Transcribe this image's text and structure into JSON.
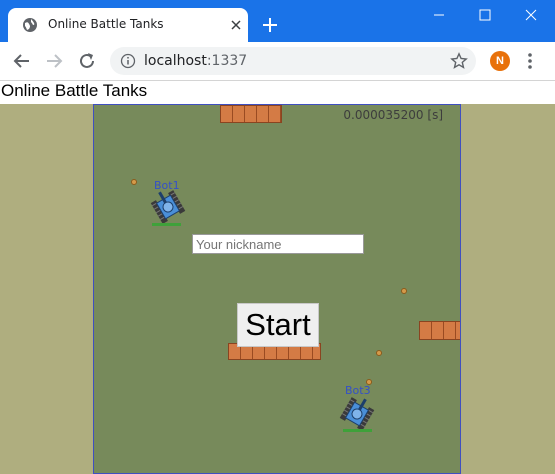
{
  "browser": {
    "tab_title": "Online Battle Tanks",
    "url_host": "localhost",
    "url_port": ":1337",
    "profile_initial": "N",
    "accent_color": "#1a73e8",
    "profile_color": "#e8710a"
  },
  "page": {
    "heading": "Online Battle Tanks"
  },
  "game": {
    "timer": "0.000035200 [s]",
    "nickname_placeholder": "Your nickname",
    "nickname_value": "",
    "start_label": "Start",
    "bots": [
      {
        "label": "Bot1",
        "color": "#4a8fd8",
        "health": 1.0
      },
      {
        "label": "Bot3",
        "color": "#4a8fd8",
        "health": 1.0
      }
    ],
    "colors": {
      "arena": "#778a5b",
      "outer": "#afae7f",
      "brick": "#d47b45",
      "border": "#3f4fc0",
      "health": "#3fa13a"
    }
  }
}
